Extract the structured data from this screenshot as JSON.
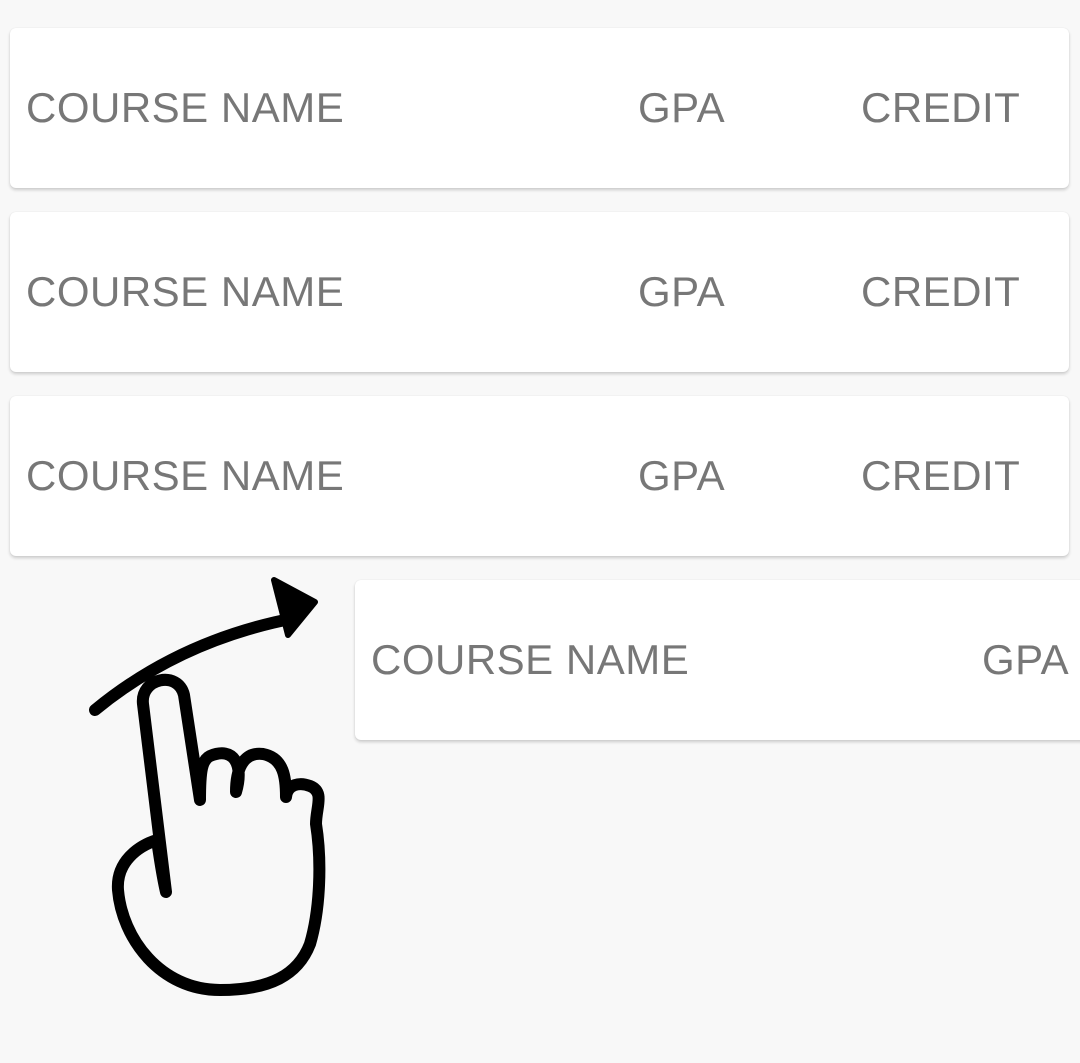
{
  "course_list": {
    "rows": [
      {
        "name": "COURSE NAME",
        "gpa": "GPA",
        "credit": "CREDIT"
      },
      {
        "name": "COURSE NAME",
        "gpa": "GPA",
        "credit": "CREDIT"
      },
      {
        "name": "COURSE NAME",
        "gpa": "GPA",
        "credit": "CREDIT"
      },
      {
        "name": "COURSE NAME",
        "gpa": "GPA"
      }
    ]
  },
  "colors": {
    "background": "#f8f8f8",
    "card": "#ffffff",
    "text": "#777777",
    "gesture": "#000000"
  },
  "icons": {
    "gesture": "swipe-right-hand-icon",
    "arrow": "curved-arrow-icon"
  }
}
